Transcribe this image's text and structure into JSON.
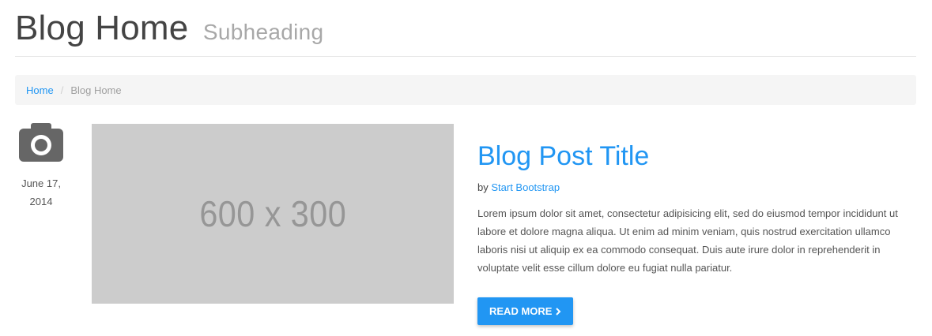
{
  "header": {
    "title": "Blog Home",
    "subheading": "Subheading"
  },
  "breadcrumb": {
    "home": "Home",
    "separator": "/",
    "current": "Blog Home"
  },
  "post": {
    "date_line1": "June 17,",
    "date_line2": "2014",
    "image_placeholder": "600 x 300",
    "title": "Blog Post Title",
    "byline_prefix": "by",
    "author": "Start Bootstrap",
    "excerpt": "Lorem ipsum dolor sit amet, consectetur adipisicing elit, sed do eiusmod tempor incididunt ut labore et dolore magna aliqua. Ut enim ad minim veniam, quis nostrud exercitation ullamco laboris nisi ut aliquip ex ea commodo consequat. Duis aute irure dolor in reprehenderit in voluptate velit esse cillum dolore eu fugiat nulla pariatur.",
    "read_more": "READ MORE",
    "read_more_icon": "chevron-right-icon",
    "post_icon": "camera-icon"
  },
  "colors": {
    "accent": "#2196f3",
    "placeholder_bg": "#cccccc",
    "breadcrumb_bg": "#f5f5f5"
  }
}
